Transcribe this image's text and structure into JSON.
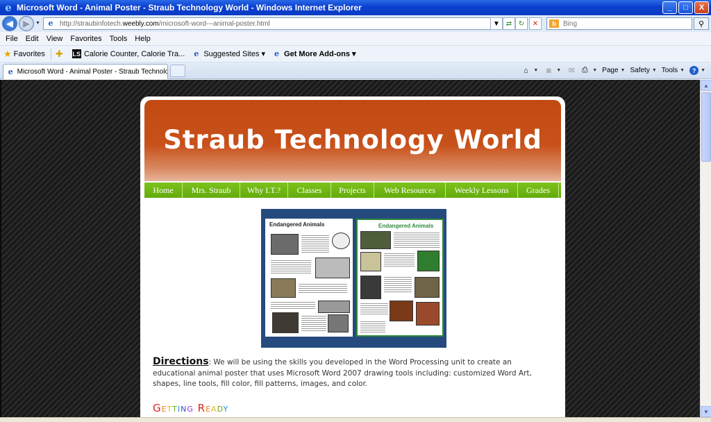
{
  "window": {
    "title": "Microsoft Word - Animal Poster - Straub Technology World - Windows Internet Explorer",
    "controls": {
      "minimize": "_",
      "maximize": "□",
      "close": "X"
    }
  },
  "address_bar": {
    "url_prefix": "http://straubinfotech.",
    "url_domain": "weebly.com",
    "url_path": "/microsoft-word---animal-poster.html",
    "search_placeholder": "Bing",
    "bing_label": "b"
  },
  "menu": [
    "File",
    "Edit",
    "View",
    "Favorites",
    "Tools",
    "Help"
  ],
  "favorites_bar": {
    "favorites_label": "Favorites",
    "items": [
      {
        "label": "Calorie Counter, Calorie Tra...",
        "icon": "LS"
      },
      {
        "label": "Suggested Sites ▾",
        "icon": "e"
      },
      {
        "label": "Get More Add-ons ▾",
        "icon": "e"
      }
    ]
  },
  "tab": {
    "label": "Microsoft Word - Animal Poster - Straub Technology ..."
  },
  "command_bar": {
    "page": "Page",
    "safety": "Safety",
    "tools": "Tools",
    "help": "?"
  },
  "site": {
    "title": "Straub Technology World",
    "nav": [
      "Home",
      "Mrs. Straub",
      "Why I.T.?",
      "Classes",
      "Projects",
      "Web Resources",
      "Weekly Lessons",
      "Grades"
    ]
  },
  "poster": {
    "left_heading": "Endangered Animals",
    "right_heading": "Endangered Animals"
  },
  "content": {
    "directions_label": "Directions",
    "directions_text": ": We will be using the skills you developed in the Word Processing unit to create an educational animal poster that uses Microsoft Word 2007 drawing tools including: customized Word Art, shapes, line tools, fill color, fill patterns, images, and color.",
    "getting_ready_letters": [
      {
        "ch": "G",
        "color": "#d9261c"
      },
      {
        "ch": "e",
        "color": "#e8821e"
      },
      {
        "ch": "t",
        "color": "#e8b81e"
      },
      {
        "ch": "t",
        "color": "#6aa81c"
      },
      {
        "ch": "i",
        "color": "#1c8ad9"
      },
      {
        "ch": "n",
        "color": "#3a4fd0"
      },
      {
        "ch": "g",
        "color": "#8a3ad0"
      },
      {
        "ch": " ",
        "color": "#000000"
      },
      {
        "ch": "R",
        "color": "#d9261c"
      },
      {
        "ch": "e",
        "color": "#e8821e"
      },
      {
        "ch": "a",
        "color": "#e8b81e"
      },
      {
        "ch": "d",
        "color": "#6aa81c"
      },
      {
        "ch": "y",
        "color": "#1c8ad9"
      }
    ]
  },
  "colors": {
    "banner": "#c24a12",
    "nav": "#70b814",
    "poster_frame": "#254b7e"
  }
}
